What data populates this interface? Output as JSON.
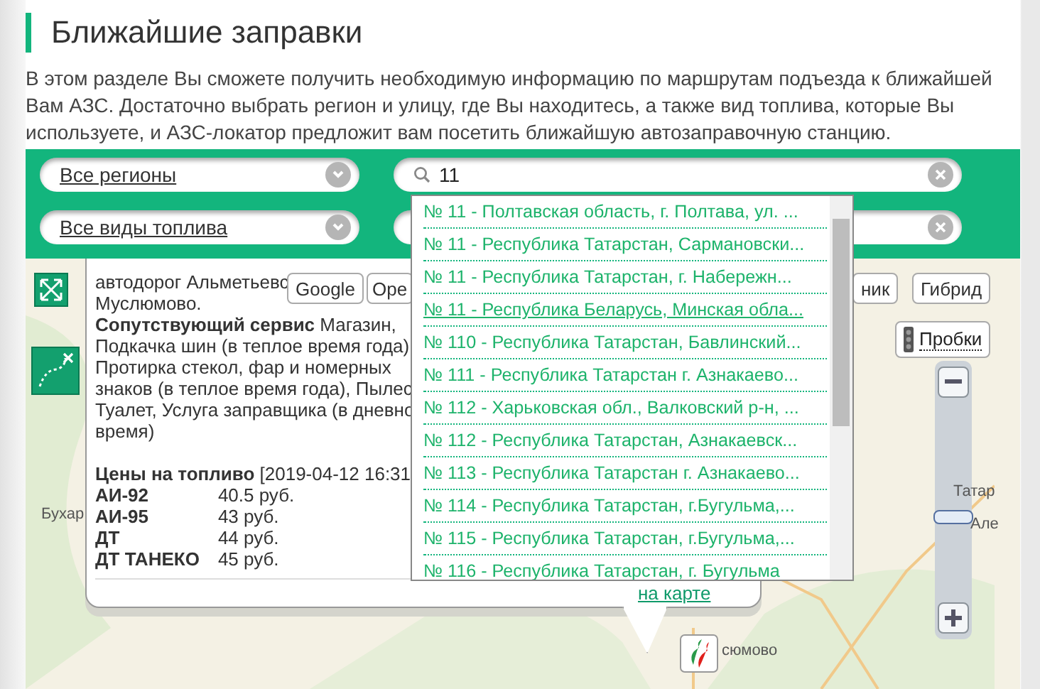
{
  "page": {
    "title": "Ближайшие заправки",
    "intro": "В этом разделе Вы сможете получить необходимую информацию по маршрутам подъезда к ближайшей Вам АЗС. Достаточно выбрать регион и улицу, где Вы находитесь, а также вид топлива, которые Вы используете, и АЗС-локатор предложит вам посетить ближайшую автозаправочную станцию."
  },
  "filters": {
    "region": "Все регионы",
    "fuel": "Все виды топлива",
    "search": {
      "value": "11"
    }
  },
  "suggestions": [
    {
      "label": "№ 11 - Полтавская область, г. Полтава, ул. ...",
      "selected": false
    },
    {
      "label": "№ 11 - Республика Татарстан, Сармановски...",
      "selected": false
    },
    {
      "label": "№ 11 - Республика Татарстан, г. Набережн...",
      "selected": false
    },
    {
      "label": "№ 11 - Республика Беларусь, Минская обла...",
      "selected": true
    },
    {
      "label": "№ 110 - Республика Татарстан, Бавлинский...",
      "selected": false
    },
    {
      "label": "№ 111 - Республика Татарстан г. Азнакаево...",
      "selected": false
    },
    {
      "label": "№ 112 - Харьковская обл., Валковский р-н, ...",
      "selected": false
    },
    {
      "label": "№ 112 - Республика Татарстан, Азнакаевск...",
      "selected": false
    },
    {
      "label": "№ 113 - Республика Татарстан г. Азнакаево...",
      "selected": false
    },
    {
      "label": "№ 114 - Республика Татарстан, г.Бугульма,...",
      "selected": false
    },
    {
      "label": "№ 115 - Республика Татарстан, г.Бугульма,...",
      "selected": false
    },
    {
      "label": "№ 116 - Республика Татарстан, г. Бугульма",
      "selected": false
    }
  ],
  "map": {
    "type_buttons": [
      "Google",
      "Оре",
      "ник",
      "Гибрид"
    ],
    "traffic": "Пробки",
    "zoom": {
      "level": 0.42
    },
    "labels": [
      {
        "text": "Бухар",
        "kind": "left"
      },
      {
        "text": "Татар",
        "kind": "right-top"
      },
      {
        "text": "Але",
        "kind": "right-bottom"
      },
      {
        "text": "сюмово",
        "kind": "marker"
      }
    ],
    "popup": {
      "lines": [
        "автодорог Альметьевс",
        "Муслюмово.",
        "**Сопутствующий сервис** Магазин,",
        "Подкачка шин (в теплое время года)",
        "Протирка стекол, фар и номерных",
        "знаков (в теплое время года), Пылес",
        "Туалет, Услуга заправщика (в дневно",
        "время)"
      ],
      "prices_title": "**Цены на топливо** [2019-04-12 16:31",
      "prices": [
        {
          "fuel": "АИ-92",
          "price": "40.5 руб."
        },
        {
          "fuel": "АИ-95",
          "price": "43 руб."
        },
        {
          "fuel": "ДТ",
          "price": "44 руб."
        },
        {
          "fuel": "ДТ ТАНЕКО",
          "price": "45 руб."
        }
      ],
      "link": "на карте"
    }
  }
}
